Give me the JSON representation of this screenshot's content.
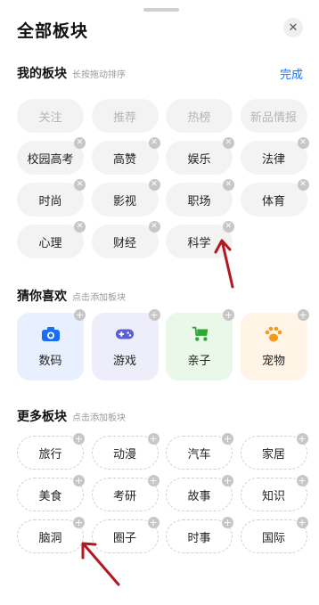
{
  "header": {
    "title": "全部板块"
  },
  "my_section": {
    "title": "我的板块",
    "hint": "长按拖动排序",
    "done_label": "完成",
    "items": [
      "关注",
      "推荐",
      "热榜",
      "新品情报",
      "校园高考",
      "高赞",
      "娱乐",
      "法律",
      "时尚",
      "影视",
      "职场",
      "体育",
      "心理",
      "财经",
      "科学"
    ]
  },
  "guess_section": {
    "title": "猜你喜欢",
    "hint": "点击添加板块",
    "items": [
      {
        "label": "数码",
        "bg": "#e8f0ff",
        "icon": "camera-icon",
        "color": "#1a6ef5"
      },
      {
        "label": "游戏",
        "bg": "#eeeefb",
        "icon": "gamepad-icon",
        "color": "#5a5fd6"
      },
      {
        "label": "亲子",
        "bg": "#e9f8e8",
        "icon": "stroller-icon",
        "color": "#2ea836"
      },
      {
        "label": "宠物",
        "bg": "#fff4e6",
        "icon": "paw-icon",
        "color": "#f39a1d"
      }
    ]
  },
  "more_section": {
    "title": "更多板块",
    "hint": "点击添加板块",
    "items": [
      "旅行",
      "动漫",
      "汽车",
      "家居",
      "美食",
      "考研",
      "故事",
      "知识",
      "脑洞",
      "圈子",
      "时事",
      "国际"
    ]
  }
}
